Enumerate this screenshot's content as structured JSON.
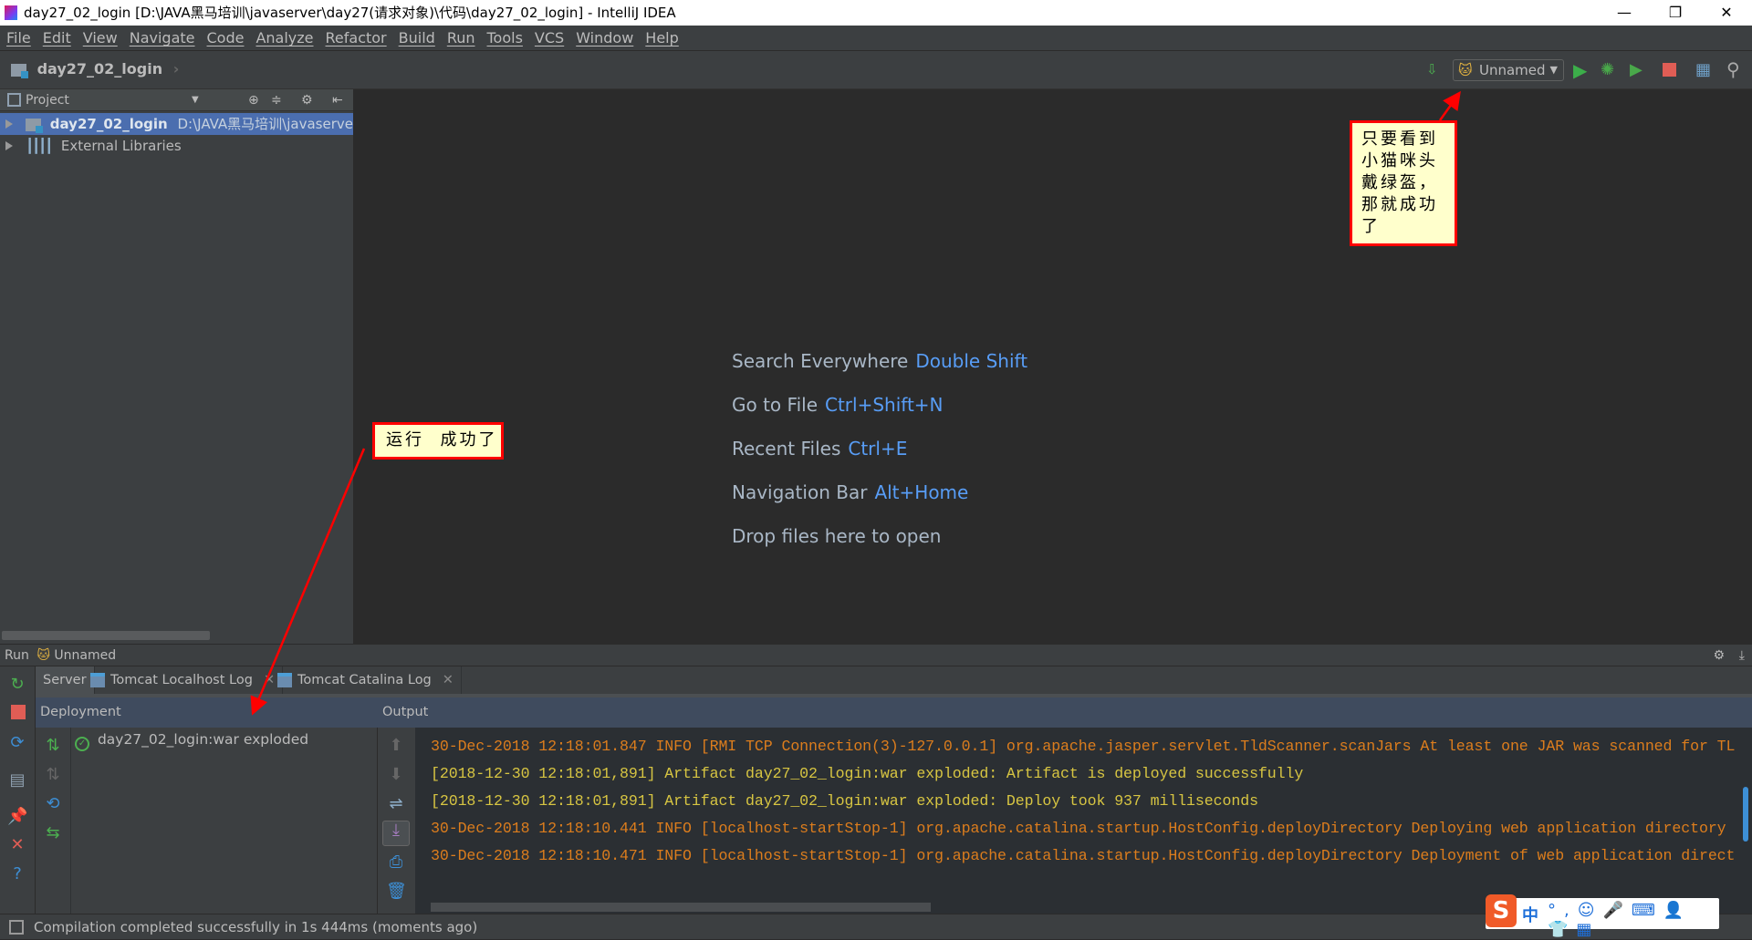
{
  "window": {
    "title": "day27_02_login [D:\\JAVA黑马培训\\javaserver\\day27(请求对象)\\代码\\day27_02_login] - IntelliJ IDEA"
  },
  "menu": [
    "File",
    "Edit",
    "View",
    "Navigate",
    "Code",
    "Analyze",
    "Refactor",
    "Build",
    "Run",
    "Tools",
    "VCS",
    "Window",
    "Help"
  ],
  "navbar": {
    "project": "day27_02_login",
    "run_config": "Unnamed"
  },
  "project_panel": {
    "title": "Project",
    "items": [
      {
        "name": "day27_02_login",
        "path": "D:\\JAVA黑马培训\\javaserver\\d"
      },
      {
        "name": "External Libraries"
      }
    ]
  },
  "welcome": [
    {
      "label": "Search Everywhere",
      "key": "Double Shift"
    },
    {
      "label": "Go to File",
      "key": "Ctrl+Shift+N"
    },
    {
      "label": "Recent Files",
      "key": "Ctrl+E"
    },
    {
      "label": "Navigation Bar",
      "key": "Alt+Home"
    },
    {
      "label": "Drop files here to open",
      "key": ""
    }
  ],
  "run": {
    "label": "Run",
    "config": "Unnamed",
    "tabs": [
      "Server",
      "Tomcat Localhost Log",
      "Tomcat Catalina Log"
    ],
    "deployment_header": "Deployment",
    "output_header": "Output",
    "artifact": "day27_02_login:war exploded",
    "log": [
      {
        "text": "30-Dec-2018 12:18:01.847 INFO [RMI TCP Connection(3)-127.0.0.1] org.apache.jasper.servlet.TldScanner.scanJars At least one JAR was scanned for TL",
        "color": "#dc7d1d"
      },
      {
        "text": "[2018-12-30 12:18:01,891] Artifact day27_02_login:war exploded: Artifact is deployed successfully",
        "color": "#d7c542"
      },
      {
        "text": "[2018-12-30 12:18:01,891] Artifact day27_02_login:war exploded: Deploy took 937 milliseconds",
        "color": "#d7c542"
      },
      {
        "text": "30-Dec-2018 12:18:10.441 INFO [localhost-startStop-1] org.apache.catalina.startup.HostConfig.deployDirectory Deploying web application directory",
        "color": "#dc7d1d"
      },
      {
        "text": "30-Dec-2018 12:18:10.471 INFO [localhost-startStop-1] org.apache.catalina.startup.HostConfig.deployDirectory Deployment of web application direct",
        "color": "#dc7d1d"
      }
    ]
  },
  "status": "Compilation completed successfully in 1s 444ms (moments ago)",
  "annotations": {
    "top": "只要看到小猫咪头戴绿盔，那就成功了",
    "middle": "运行  成功了"
  },
  "ime": {
    "lang": "中"
  }
}
